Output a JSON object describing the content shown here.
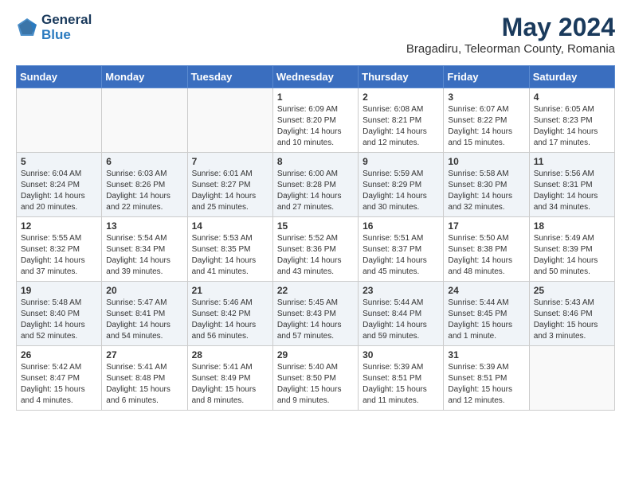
{
  "header": {
    "logo_general": "General",
    "logo_blue": "Blue",
    "month_title": "May 2024",
    "subtitle": "Bragadiru, Teleorman County, Romania"
  },
  "days_of_week": [
    "Sunday",
    "Monday",
    "Tuesday",
    "Wednesday",
    "Thursday",
    "Friday",
    "Saturday"
  ],
  "weeks": [
    [
      {
        "day": "",
        "sunrise": "",
        "sunset": "",
        "daylight": ""
      },
      {
        "day": "",
        "sunrise": "",
        "sunset": "",
        "daylight": ""
      },
      {
        "day": "",
        "sunrise": "",
        "sunset": "",
        "daylight": ""
      },
      {
        "day": "1",
        "sunrise": "Sunrise: 6:09 AM",
        "sunset": "Sunset: 8:20 PM",
        "daylight": "Daylight: 14 hours and 10 minutes."
      },
      {
        "day": "2",
        "sunrise": "Sunrise: 6:08 AM",
        "sunset": "Sunset: 8:21 PM",
        "daylight": "Daylight: 14 hours and 12 minutes."
      },
      {
        "day": "3",
        "sunrise": "Sunrise: 6:07 AM",
        "sunset": "Sunset: 8:22 PM",
        "daylight": "Daylight: 14 hours and 15 minutes."
      },
      {
        "day": "4",
        "sunrise": "Sunrise: 6:05 AM",
        "sunset": "Sunset: 8:23 PM",
        "daylight": "Daylight: 14 hours and 17 minutes."
      }
    ],
    [
      {
        "day": "5",
        "sunrise": "Sunrise: 6:04 AM",
        "sunset": "Sunset: 8:24 PM",
        "daylight": "Daylight: 14 hours and 20 minutes."
      },
      {
        "day": "6",
        "sunrise": "Sunrise: 6:03 AM",
        "sunset": "Sunset: 8:26 PM",
        "daylight": "Daylight: 14 hours and 22 minutes."
      },
      {
        "day": "7",
        "sunrise": "Sunrise: 6:01 AM",
        "sunset": "Sunset: 8:27 PM",
        "daylight": "Daylight: 14 hours and 25 minutes."
      },
      {
        "day": "8",
        "sunrise": "Sunrise: 6:00 AM",
        "sunset": "Sunset: 8:28 PM",
        "daylight": "Daylight: 14 hours and 27 minutes."
      },
      {
        "day": "9",
        "sunrise": "Sunrise: 5:59 AM",
        "sunset": "Sunset: 8:29 PM",
        "daylight": "Daylight: 14 hours and 30 minutes."
      },
      {
        "day": "10",
        "sunrise": "Sunrise: 5:58 AM",
        "sunset": "Sunset: 8:30 PM",
        "daylight": "Daylight: 14 hours and 32 minutes."
      },
      {
        "day": "11",
        "sunrise": "Sunrise: 5:56 AM",
        "sunset": "Sunset: 8:31 PM",
        "daylight": "Daylight: 14 hours and 34 minutes."
      }
    ],
    [
      {
        "day": "12",
        "sunrise": "Sunrise: 5:55 AM",
        "sunset": "Sunset: 8:32 PM",
        "daylight": "Daylight: 14 hours and 37 minutes."
      },
      {
        "day": "13",
        "sunrise": "Sunrise: 5:54 AM",
        "sunset": "Sunset: 8:34 PM",
        "daylight": "Daylight: 14 hours and 39 minutes."
      },
      {
        "day": "14",
        "sunrise": "Sunrise: 5:53 AM",
        "sunset": "Sunset: 8:35 PM",
        "daylight": "Daylight: 14 hours and 41 minutes."
      },
      {
        "day": "15",
        "sunrise": "Sunrise: 5:52 AM",
        "sunset": "Sunset: 8:36 PM",
        "daylight": "Daylight: 14 hours and 43 minutes."
      },
      {
        "day": "16",
        "sunrise": "Sunrise: 5:51 AM",
        "sunset": "Sunset: 8:37 PM",
        "daylight": "Daylight: 14 hours and 45 minutes."
      },
      {
        "day": "17",
        "sunrise": "Sunrise: 5:50 AM",
        "sunset": "Sunset: 8:38 PM",
        "daylight": "Daylight: 14 hours and 48 minutes."
      },
      {
        "day": "18",
        "sunrise": "Sunrise: 5:49 AM",
        "sunset": "Sunset: 8:39 PM",
        "daylight": "Daylight: 14 hours and 50 minutes."
      }
    ],
    [
      {
        "day": "19",
        "sunrise": "Sunrise: 5:48 AM",
        "sunset": "Sunset: 8:40 PM",
        "daylight": "Daylight: 14 hours and 52 minutes."
      },
      {
        "day": "20",
        "sunrise": "Sunrise: 5:47 AM",
        "sunset": "Sunset: 8:41 PM",
        "daylight": "Daylight: 14 hours and 54 minutes."
      },
      {
        "day": "21",
        "sunrise": "Sunrise: 5:46 AM",
        "sunset": "Sunset: 8:42 PM",
        "daylight": "Daylight: 14 hours and 56 minutes."
      },
      {
        "day": "22",
        "sunrise": "Sunrise: 5:45 AM",
        "sunset": "Sunset: 8:43 PM",
        "daylight": "Daylight: 14 hours and 57 minutes."
      },
      {
        "day": "23",
        "sunrise": "Sunrise: 5:44 AM",
        "sunset": "Sunset: 8:44 PM",
        "daylight": "Daylight: 14 hours and 59 minutes."
      },
      {
        "day": "24",
        "sunrise": "Sunrise: 5:44 AM",
        "sunset": "Sunset: 8:45 PM",
        "daylight": "Daylight: 15 hours and 1 minute."
      },
      {
        "day": "25",
        "sunrise": "Sunrise: 5:43 AM",
        "sunset": "Sunset: 8:46 PM",
        "daylight": "Daylight: 15 hours and 3 minutes."
      }
    ],
    [
      {
        "day": "26",
        "sunrise": "Sunrise: 5:42 AM",
        "sunset": "Sunset: 8:47 PM",
        "daylight": "Daylight: 15 hours and 4 minutes."
      },
      {
        "day": "27",
        "sunrise": "Sunrise: 5:41 AM",
        "sunset": "Sunset: 8:48 PM",
        "daylight": "Daylight: 15 hours and 6 minutes."
      },
      {
        "day": "28",
        "sunrise": "Sunrise: 5:41 AM",
        "sunset": "Sunset: 8:49 PM",
        "daylight": "Daylight: 15 hours and 8 minutes."
      },
      {
        "day": "29",
        "sunrise": "Sunrise: 5:40 AM",
        "sunset": "Sunset: 8:50 PM",
        "daylight": "Daylight: 15 hours and 9 minutes."
      },
      {
        "day": "30",
        "sunrise": "Sunrise: 5:39 AM",
        "sunset": "Sunset: 8:51 PM",
        "daylight": "Daylight: 15 hours and 11 minutes."
      },
      {
        "day": "31",
        "sunrise": "Sunrise: 5:39 AM",
        "sunset": "Sunset: 8:51 PM",
        "daylight": "Daylight: 15 hours and 12 minutes."
      },
      {
        "day": "",
        "sunrise": "",
        "sunset": "",
        "daylight": ""
      }
    ]
  ]
}
